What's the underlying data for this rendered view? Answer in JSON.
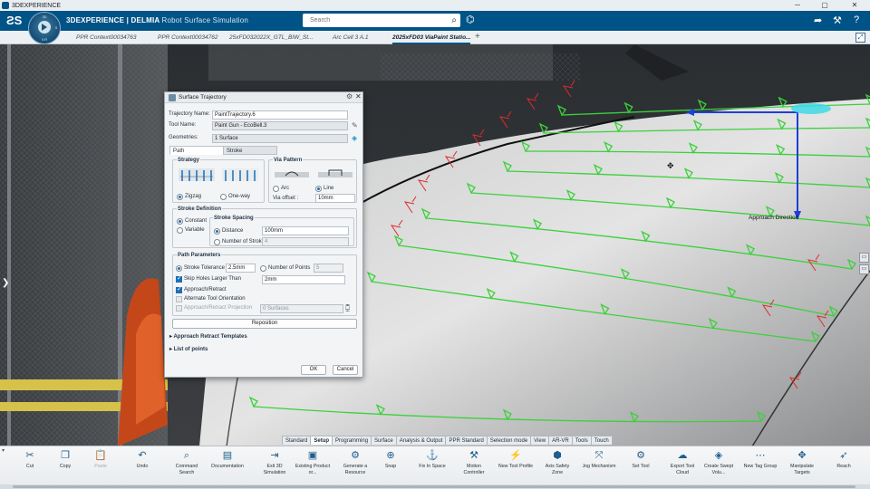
{
  "os": {
    "title": "3DEXPERIENCE",
    "minimize": "─",
    "maximize": "▢",
    "close": "✕"
  },
  "header": {
    "ds_logo": "ƧS",
    "compass_top": "3D",
    "compass_right": "5",
    "compass_bottom": "V.R",
    "brand_main": "3DEXPERIENCE | DELMIA",
    "brand_app": "Robot Surface Simulation",
    "search_placeholder": "Search",
    "accent_color": "#005386"
  },
  "tabs": [
    {
      "label": "PPR Context00034763",
      "active": false
    },
    {
      "label": "PPR Context00034762",
      "active": false
    },
    {
      "label": "25xFD032022X_GTL_BIW_St...",
      "active": false
    },
    {
      "label": "Arc Cell 3 A.1",
      "active": false
    },
    {
      "label": "2025xFD03 ViaPaint Statio...",
      "active": true
    }
  ],
  "tab_add": "+",
  "viewport": {
    "approach_label": "Approach Direction",
    "trajectory_color": "#3bd13b",
    "marker_color": "#e02b2b"
  },
  "dialog": {
    "title": "Surface Trajectory",
    "trajectory_name_label": "Trajectory Name:",
    "trajectory_name": "PaintTrajectory.6",
    "tool_name_label": "Tool Name:",
    "tool_name": "Paint Gun - EcoBell.3",
    "geometries_label": "Geometries:",
    "geometries": "1 Surface",
    "tab_path": "Path",
    "tab_stroke": "Stroke",
    "strategy": {
      "title": "Strategy",
      "zigzag": "Zigzag",
      "oneway": "One-way",
      "selected": "Zigzag"
    },
    "via_pattern": {
      "title": "Via Pattern",
      "arc": "Arc",
      "line": "Line",
      "selected": "Line",
      "offset_label": "Via offset :",
      "offset_value": "10mm"
    },
    "stroke_def": {
      "title": "Stroke Definition",
      "constant": "Constant",
      "variable": "Variable",
      "selected": "Constant",
      "spacing_title": "Stroke Spacing",
      "distance": "Distance",
      "distance_value": "100mm",
      "num_strokes": "Number of Strokes",
      "num_strokes_value": "4"
    },
    "path_params": {
      "title": "Path Parameters",
      "stroke_tol": "Stroke Tolerance",
      "stroke_tol_value": "2.5mm",
      "num_points": "Number of Points",
      "num_points_value": "5",
      "skip_holes": "Skip Holes Larger Than",
      "skip_holes_value": "2mm",
      "approach_retract": "Approach/Retract",
      "alternate_orient": "Alternate Tool Orientation",
      "ar_projection": "Approach/Retract Projection",
      "ar_projection_value": "0 Surfaces"
    },
    "reposition": "Reposition",
    "approach_templates": "Approach Retract Templates",
    "list_points": "List of points",
    "ok": "OK",
    "cancel": "Cancel"
  },
  "section_tabs": [
    "Standard",
    "Setup",
    "Programming",
    "Surface",
    "Analysis & Output",
    "PPR Standard",
    "Selection mode",
    "View",
    "AR-VR",
    "Tools",
    "Touch"
  ],
  "section_active": "Setup",
  "tools": [
    {
      "label": "Cut",
      "icon": "✂",
      "disabled": false
    },
    {
      "label": "Copy",
      "icon": "❐",
      "disabled": false
    },
    {
      "label": "Paste",
      "icon": "📋",
      "disabled": true
    },
    {
      "label": "Undo",
      "icon": "↶",
      "disabled": false
    },
    {
      "label": "Command Search",
      "icon": "⌕",
      "disabled": false
    },
    {
      "label": "Documentation",
      "icon": "▤",
      "disabled": false
    },
    {
      "label": "Exit 3D Simulation",
      "icon": "⇥",
      "disabled": false
    },
    {
      "label": "Existing Product or...",
      "icon": "▣",
      "disabled": false
    },
    {
      "label": "Generate a Resource",
      "icon": "⚙",
      "disabled": false
    },
    {
      "label": "Snap",
      "icon": "⊕",
      "disabled": false
    },
    {
      "label": "Fix In Space",
      "icon": "⚓",
      "disabled": false
    },
    {
      "label": "Motion Controller",
      "icon": "⚒",
      "disabled": false
    },
    {
      "label": "New Tool Profile",
      "icon": "⚡",
      "disabled": false
    },
    {
      "label": "Axis Safety Zone",
      "icon": "⬢",
      "disabled": false
    },
    {
      "label": "Jog Mechanism",
      "icon": "⤧",
      "disabled": false
    },
    {
      "label": "Set Tool",
      "icon": "⚙",
      "disabled": false
    },
    {
      "label": "Export Tool Cloud",
      "icon": "☁",
      "disabled": false
    },
    {
      "label": "Create Swept Volu...",
      "icon": "◈",
      "disabled": false
    },
    {
      "label": "New Tag Group",
      "icon": "⋯",
      "disabled": false
    },
    {
      "label": "Manipulate Targets",
      "icon": "✥",
      "disabled": false
    },
    {
      "label": "Reach",
      "icon": "➶",
      "disabled": false
    }
  ]
}
